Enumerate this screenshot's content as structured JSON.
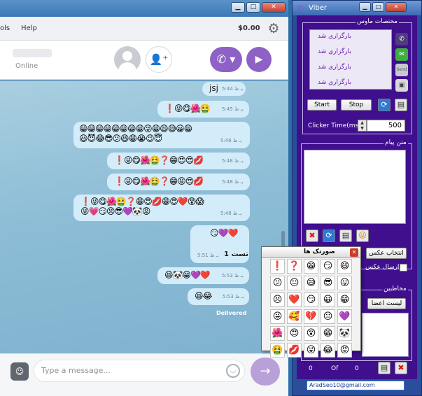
{
  "main_window": {
    "menu": {
      "tools_label": "ols",
      "help_label": "Help",
      "balance": "$0.00"
    },
    "contact": {
      "status": "Online"
    },
    "messages": [
      {
        "text": "jsj",
        "time": "بـ ظ 5:44"
      },
      {
        "emojis": "❗😜😋🌺🤮",
        "time": "بـ ظ 5:45"
      },
      {
        "emojis": "😁😁😁😁😁😁😁😁😜😁😄😅😀😁\n😃😈😂😎😕😆😁😭😉😇",
        "time": "بـ ظ 5:46"
      },
      {
        "emojis": "❗😜😋🌺🤮❓😁😍😍💋",
        "time": "بـ ظ 5:48"
      },
      {
        "emojis": "❗😜😋🌺🤮❓😁😝😍💋",
        "time": "بـ ظ 5:48"
      },
      {
        "emojis": "❗😜😋🌺🤮❓😁😍💋😁😍❤️😵😱\n😜💗😏😣😎💜🐼😡",
        "time": "بـ ظ 5:48"
      },
      {
        "emojis": "😏💜❤️",
        "text": "تست 1",
        "time": "بـ ظ 5:51"
      },
      {
        "emojis": "😆🐼😁💜❤️",
        "time": "بـ ظ 5:53"
      },
      {
        "emojis": "😆😂",
        "time": "بـ ظ 5:53"
      }
    ],
    "delivered": "Delivered",
    "compose": {
      "placeholder": "Type a message..."
    }
  },
  "tool_panel": {
    "title": "Viber",
    "mouse_group_title": "مختصات ماوس",
    "mouse_items": [
      "بارگزاری شد",
      "بارگزاری شد",
      "بارگزاری شد",
      "بارگزاری شد"
    ],
    "side_icons": [
      "viber-icon",
      "wechat-icon",
      "send-icon",
      "image-icon"
    ],
    "send_icon_label": "Send",
    "start_label": "Start",
    "stop_label": "Stop",
    "clicker_label": "Clicker Time(ms)",
    "clicker_value": "500",
    "message_group_title": "متن پیام",
    "select_image_label": "انتخاب عکس",
    "send_image_label": "ارسال عکس",
    "contacts_group_title": "مخاطبین",
    "contacts_list_label": "لیست اعضا",
    "counter": {
      "current": "0",
      "of_label": "Of",
      "total": "0"
    },
    "email": "AradSeo10@gmail.com"
  },
  "emoticon_popup": {
    "title": "صورتک ها",
    "emoticons": [
      "❗",
      "❓",
      "😁",
      "😏",
      "😄",
      "😕",
      "😐",
      "😅",
      "😎",
      "😛",
      "😣",
      "❤️",
      "😏",
      "😀",
      "😁",
      "😜",
      "🥰",
      "💔",
      "😐",
      "💜",
      "🌺",
      "😍",
      "😵",
      "😁",
      "🐼",
      "🤮",
      "💋",
      "😜",
      "😂",
      "😡"
    ]
  },
  "colors": {
    "viber_purple": "#8e61c6",
    "bubble": "#d3ecf9",
    "tool_body": "#3f0f8d",
    "mouse_item_text": "#6a1ab0"
  }
}
